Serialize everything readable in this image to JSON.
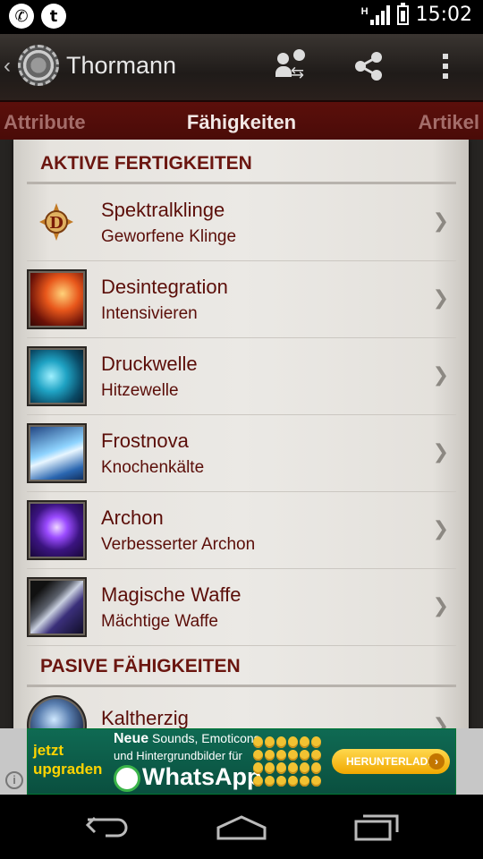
{
  "status_bar": {
    "time": "15:02",
    "signal_label": "H",
    "app_icons": [
      "whatsapp-icon",
      "tumblr-icon"
    ]
  },
  "action_bar": {
    "title": "Thormann",
    "icons": [
      "switch-profile-icon",
      "share-icon",
      "overflow-menu-icon"
    ]
  },
  "tabs": {
    "left": "Attribute",
    "active": "Fähigkeiten",
    "right": "Artikel"
  },
  "sections": {
    "active": "AKTIVE FERTIGKEITEN",
    "passive": "PASIVE FÄHIGKEITEN"
  },
  "active_skills": [
    {
      "name": "Spektralklinge",
      "rune": "Geworfene Klinge",
      "icon": "diablo-d-icon"
    },
    {
      "name": "Desintegration",
      "rune": "Intensivieren",
      "icon": "disintegrate-icon"
    },
    {
      "name": "Druckwelle",
      "rune": "Hitzewelle",
      "icon": "wave-of-force-icon"
    },
    {
      "name": "Frostnova",
      "rune": "Knochenkälte",
      "icon": "frost-nova-icon"
    },
    {
      "name": "Archon",
      "rune": "Verbesserter Archon",
      "icon": "archon-icon"
    },
    {
      "name": "Magische Waffe",
      "rune": "Mächtige Waffe",
      "icon": "magic-weapon-icon"
    }
  ],
  "passive_skills": [
    {
      "name": "Kaltherzig",
      "icon": "cold-blooded-icon"
    }
  ],
  "ad": {
    "tagline_1": "jetzt",
    "tagline_2": "upgraden",
    "line_1_bold": "Neue",
    "line_1_rest": " Sounds, Emoticons",
    "line_2": "und Hintergrundbilder für",
    "brand": "WhatsApp",
    "cta": "HERUNTERLADEN",
    "cta_arrow": "›",
    "info": "i"
  },
  "colors": {
    "accent_dark_red": "#5b0e09",
    "tab_bar": "#4f0c08",
    "parchment": "#e9e7e3"
  }
}
